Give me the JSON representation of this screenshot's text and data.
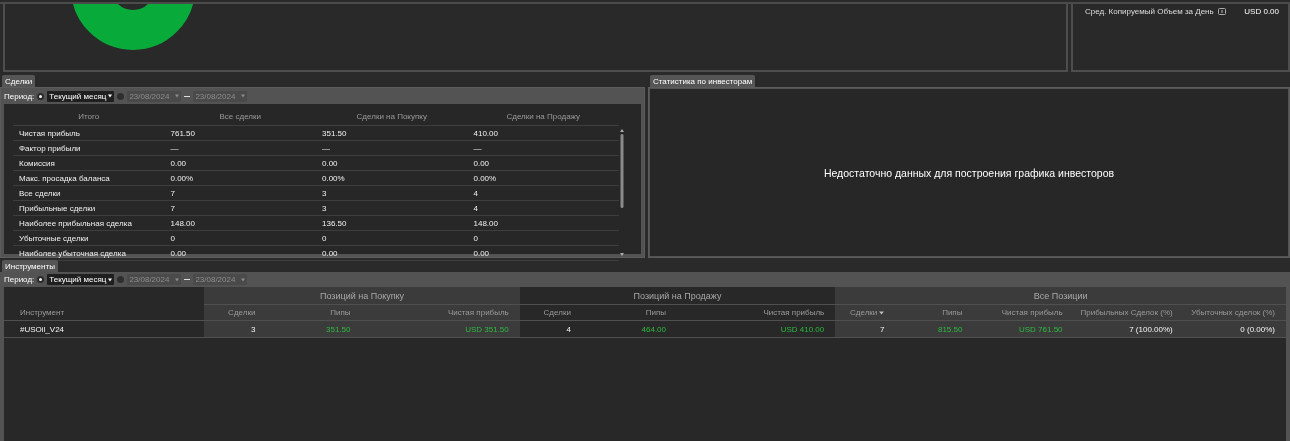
{
  "overview": {
    "chart": {
      "kind": "donut"
    },
    "stats": [
      {
        "label": "Сред. Копируемый Объем за День",
        "value": "USD 0.00",
        "info": true
      }
    ]
  },
  "deals": {
    "tabs": [
      {
        "label": "Сделки",
        "selected": true
      }
    ],
    "period": {
      "label": "Период:",
      "options": [
        {
          "kind": "preset",
          "selected": true,
          "value": "Текущий месяц"
        },
        {
          "kind": "range",
          "selected": false,
          "from": "23/08/2024",
          "to": "23/08/2024"
        }
      ]
    },
    "table": {
      "columns": [
        "Итого",
        "Все сделки",
        "Сделки на Покупку",
        "Сделки на Продажу"
      ],
      "rows": [
        {
          "label": "Чистая прибыль",
          "values": [
            "761.50",
            "351.50",
            "410.00"
          ]
        },
        {
          "label": "Фактор прибыли",
          "values": [
            "—",
            "—",
            "—"
          ]
        },
        {
          "label": "Комиссия",
          "values": [
            "0.00",
            "0.00",
            "0.00"
          ]
        },
        {
          "label": "Макс. просадка баланса",
          "values": [
            "0.00%",
            "0.00%",
            "0.00%"
          ]
        },
        {
          "label": "Все сделки",
          "values": [
            "7",
            "3",
            "4"
          ]
        },
        {
          "label": "Прибыльные сделки",
          "values": [
            "7",
            "3",
            "4"
          ]
        },
        {
          "label": "Наиболее прибыльная сделка",
          "values": [
            "148.00",
            "136.50",
            "148.00"
          ]
        },
        {
          "label": "Убыточные сделки",
          "values": [
            "0",
            "0",
            "0"
          ]
        },
        {
          "label": "Наиболее убыточная сделка",
          "values": [
            "0.00",
            "0.00",
            "0.00"
          ]
        }
      ]
    }
  },
  "investors": {
    "tabs": [
      {
        "label": "Статистика по инвесторам",
        "selected": true
      }
    ],
    "message": "Недостаточно данных для построения графика инвесторов"
  },
  "instruments": {
    "tabs": [
      {
        "label": "Инструменты",
        "selected": true
      }
    ],
    "period": {
      "label": "Период:",
      "options": [
        {
          "kind": "preset",
          "selected": true,
          "value": "Текущий месяц"
        },
        {
          "kind": "range",
          "selected": false,
          "from": "23/08/2024",
          "to": "23/08/2024"
        }
      ]
    },
    "table": {
      "first_column": "Инструмент",
      "groups": [
        {
          "title": "Позиций на Покупку",
          "columns": [
            {
              "label": "Сделки"
            },
            {
              "label": "Пипы"
            },
            {
              "label": "Чистая прибыль"
            }
          ]
        },
        {
          "title": "Позиций на Продажу",
          "columns": [
            {
              "label": "Сделки"
            },
            {
              "label": "Пипы"
            },
            {
              "label": "Чистая прибыль"
            }
          ]
        },
        {
          "title": "Все Позиции",
          "columns": [
            {
              "label": "Сделки",
              "sorted": true
            },
            {
              "label": "Пипы"
            },
            {
              "label": "Чистая прибыль"
            },
            {
              "label": "Прибыльных Сделок (%)"
            },
            {
              "label": "Убыточных сделок (%)"
            }
          ]
        }
      ],
      "rows": [
        {
          "instrument": "#USOil_V24",
          "cells": [
            {
              "text": "3",
              "positive": false
            },
            {
              "text": "351.50",
              "positive": true
            },
            {
              "text": "USD 351.50",
              "positive": true
            },
            {
              "text": "4",
              "positive": false
            },
            {
              "text": "464.00",
              "positive": true
            },
            {
              "text": "USD 410.00",
              "positive": true
            },
            {
              "text": "7",
              "positive": false
            },
            {
              "text": "815.50",
              "positive": true
            },
            {
              "text": "USD 761.50",
              "positive": true
            },
            {
              "text": "7 (100.00%)",
              "positive": false
            },
            {
              "text": "0 (0.00%)",
              "positive": false
            }
          ]
        }
      ]
    }
  }
}
